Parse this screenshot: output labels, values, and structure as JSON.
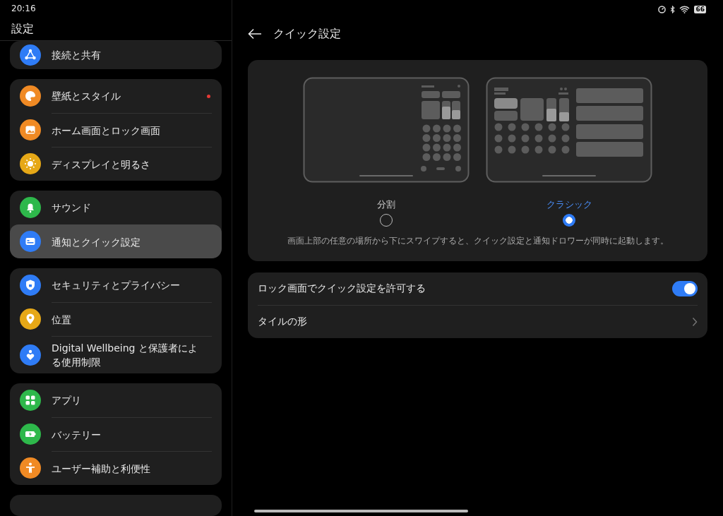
{
  "status_bar": {
    "time": "20:16",
    "battery": "66"
  },
  "sidebar": {
    "title": "設定",
    "groups": [
      {
        "items": [
          {
            "label": "接続と共有",
            "color": "#2f7cf6",
            "selected": false,
            "dot": false
          }
        ]
      },
      {
        "items": [
          {
            "label": "壁紙とスタイル",
            "color": "#f08a24",
            "selected": false,
            "dot": true
          },
          {
            "label": "ホーム画面とロック画面",
            "color": "#f08a24",
            "selected": false,
            "dot": false
          },
          {
            "label": "ディスプレイと明るさ",
            "color": "#e6a817",
            "selected": false,
            "dot": false
          }
        ]
      },
      {
        "items": [
          {
            "label": "サウンド",
            "color": "#2eb84b",
            "selected": false,
            "dot": false
          },
          {
            "label": "通知とクイック設定",
            "color": "#2f7cf6",
            "selected": true,
            "dot": false
          }
        ]
      },
      {
        "items": [
          {
            "label": "セキュリティとプライバシー",
            "color": "#2f7cf6",
            "selected": false,
            "dot": false
          },
          {
            "label": "位置",
            "color": "#e6a817",
            "selected": false,
            "dot": false
          },
          {
            "label": "Digital Wellbeing と保護者による使用制限",
            "color": "#2f7cf6",
            "selected": false,
            "dot": false
          }
        ]
      },
      {
        "items": [
          {
            "label": "アプリ",
            "color": "#2eb84b",
            "selected": false,
            "dot": false
          },
          {
            "label": "バッテリー",
            "color": "#2eb84b",
            "selected": false,
            "dot": false
          },
          {
            "label": "ユーザー補助と利便性",
            "color": "#f08a24",
            "selected": false,
            "dot": false
          }
        ]
      }
    ]
  },
  "page": {
    "title": "クイック設定",
    "layout_options": [
      {
        "kind": "split",
        "label": "分割",
        "selected": false
      },
      {
        "kind": "classic",
        "label": "クラシック",
        "selected": true
      }
    ],
    "description": "画面上部の任意の場所から下にスワイプすると、クイック設定と通知ドロワーが同時に起動します。",
    "settings": [
      {
        "kind": "toggle",
        "label": "ロック画面でクイック設定を許可する",
        "on": true
      },
      {
        "kind": "link",
        "label": "タイルの形"
      }
    ]
  }
}
